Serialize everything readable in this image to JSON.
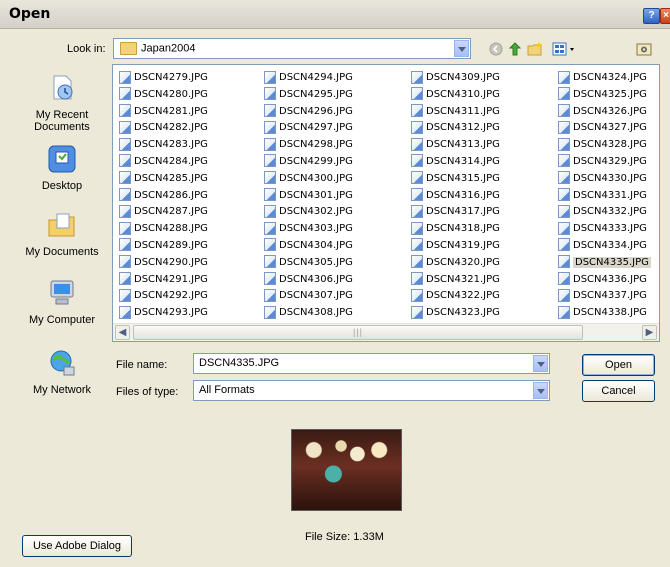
{
  "window": {
    "title": "Open"
  },
  "look_in": {
    "label": "Look in:",
    "value": "Japan2004"
  },
  "toolbar_icons": [
    "back-icon",
    "up-folder-icon",
    "new-folder-icon",
    "views-menu-icon",
    "tools-icon"
  ],
  "places": [
    {
      "label": "My Recent Documents",
      "icon": "recent-documents-icon"
    },
    {
      "label": "Desktop",
      "icon": "desktop-icon"
    },
    {
      "label": "My Documents",
      "icon": "my-documents-icon"
    },
    {
      "label": "My Computer",
      "icon": "my-computer-icon"
    },
    {
      "label": "My Network",
      "icon": "my-network-icon"
    }
  ],
  "files": {
    "col1": [
      "DSCN4279.JPG",
      "DSCN4280.JPG",
      "DSCN4281.JPG",
      "DSCN4282.JPG",
      "DSCN4283.JPG",
      "DSCN4284.JPG",
      "DSCN4285.JPG",
      "DSCN4286.JPG",
      "DSCN4287.JPG",
      "DSCN4288.JPG",
      "DSCN4289.JPG",
      "DSCN4290.JPG",
      "DSCN4291.JPG",
      "DSCN4292.JPG",
      "DSCN4293.JPG"
    ],
    "col2": [
      "DSCN4294.JPG",
      "DSCN4295.JPG",
      "DSCN4296.JPG",
      "DSCN4297.JPG",
      "DSCN4298.JPG",
      "DSCN4299.JPG",
      "DSCN4300.JPG",
      "DSCN4301.JPG",
      "DSCN4302.JPG",
      "DSCN4303.JPG",
      "DSCN4304.JPG",
      "DSCN4305.JPG",
      "DSCN4306.JPG",
      "DSCN4307.JPG",
      "DSCN4308.JPG"
    ],
    "col3": [
      "DSCN4309.JPG",
      "DSCN4310.JPG",
      "DSCN4311.JPG",
      "DSCN4312.JPG",
      "DSCN4313.JPG",
      "DSCN4314.JPG",
      "DSCN4315.JPG",
      "DSCN4316.JPG",
      "DSCN4317.JPG",
      "DSCN4318.JPG",
      "DSCN4319.JPG",
      "DSCN4320.JPG",
      "DSCN4321.JPG",
      "DSCN4322.JPG",
      "DSCN4323.JPG"
    ],
    "col4": [
      "DSCN4324.JPG",
      "DSCN4325.JPG",
      "DSCN4326.JPG",
      "DSCN4327.JPG",
      "DSCN4328.JPG",
      "DSCN4329.JPG",
      "DSCN4330.JPG",
      "DSCN4331.JPG",
      "DSCN4332.JPG",
      "DSCN4333.JPG",
      "DSCN4334.JPG",
      "DSCN4335.JPG",
      "DSCN4336.JPG",
      "DSCN4337.JPG",
      "DSCN4338.JPG"
    ],
    "selected": "DSCN4335.JPG"
  },
  "file_name": {
    "label": "File name:",
    "value": "DSCN4335.JPG"
  },
  "file_type": {
    "label": "Files of type:",
    "value": "All Formats"
  },
  "buttons": {
    "open": "Open",
    "cancel": "Cancel",
    "adobe": "Use Adobe Dialog"
  },
  "preview": {
    "file_size": "File Size: 1.33M"
  },
  "colors": {
    "dialog_bg": "#ece9d8",
    "field_border": "#7f9db9",
    "selected_bg": "#d9d6cb"
  }
}
